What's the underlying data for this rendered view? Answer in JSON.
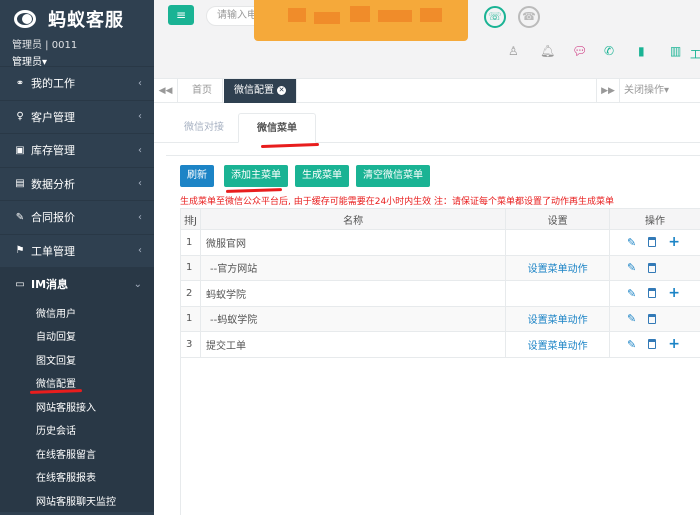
{
  "brand": {
    "title": "蚂蚁客服",
    "user": "管理员 | 0011",
    "role": "管理员▾"
  },
  "nav": [
    {
      "icon": "users-icon",
      "glyph": "⚭",
      "label": "我的工作"
    },
    {
      "icon": "user-icon",
      "glyph": "♀",
      "label": "客户管理"
    },
    {
      "icon": "inventory-icon",
      "glyph": "▣",
      "label": "库存管理"
    },
    {
      "icon": "bar-chart-icon",
      "glyph": "▤",
      "label": "数据分析"
    },
    {
      "icon": "contract-icon",
      "glyph": "✎",
      "label": "合同报价"
    },
    {
      "icon": "sitemap-icon",
      "glyph": "⚑",
      "label": "工单管理"
    }
  ],
  "im": {
    "label": "IM消息",
    "glyph": "▭"
  },
  "im_sub": [
    "微信用户",
    "自动回复",
    "图文回复",
    "微信配置",
    "网站客服接入",
    "历史会话",
    "在线客服留言",
    "在线客服报表",
    "网站客服聊天监控"
  ],
  "top": {
    "menu_glyph": "≡",
    "search_placeholder": "请输入电",
    "phone1_glyph": "☏",
    "phone2_glyph": "☎",
    "tools_label": "工"
  },
  "tabs": {
    "home": "首页",
    "active": "微信配置",
    "close_ops": "关闭操作▾"
  },
  "subtabs": [
    "微信对接",
    "微信菜单"
  ],
  "buttons": {
    "refresh": "刷新",
    "add_main": "添加主菜单",
    "generate": "生成菜单",
    "clear": "清空微信菜单"
  },
  "notice": "生成菜单至微信公众平台后, 由于缓存可能需要在24小时内生效 注：请保证每个菜单都设置了动作再生成菜单",
  "table": {
    "headers": [
      "排J",
      "名称",
      "设置",
      "操作"
    ],
    "rows": [
      {
        "idx": "1",
        "name": "微服官网",
        "set": "",
        "add": true
      },
      {
        "idx": "1",
        "name": "--官方网站",
        "set": "设置菜单动作",
        "add": false
      },
      {
        "idx": "2",
        "name": "蚂蚁学院",
        "set": "",
        "add": true
      },
      {
        "idx": "1",
        "name": "--蚂蚁学院",
        "set": "设置菜单动作",
        "add": false
      },
      {
        "idx": "3",
        "name": "提交工单",
        "set": "设置菜单动作",
        "add": true
      }
    ]
  },
  "colors": {
    "sidebar": "#2f4050",
    "primary": "#1ab394",
    "info": "#1c84c6",
    "danger": "#e81d1d"
  }
}
